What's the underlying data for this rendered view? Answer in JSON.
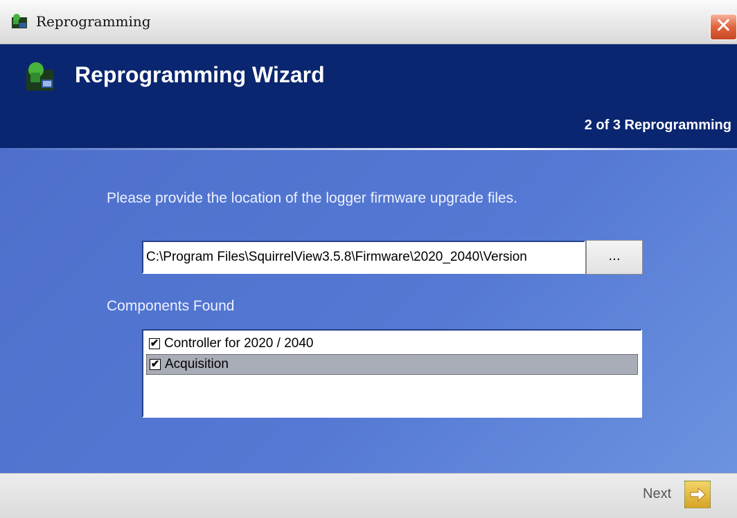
{
  "window": {
    "title": "Reprogramming",
    "close_glyph": "✕"
  },
  "header": {
    "title": "Reprogramming Wizard",
    "step": "2 of 3 Reprogramming"
  },
  "main": {
    "prompt": "Please provide the location of the logger firmware upgrade files.",
    "path_value": "C:\\Program Files\\SquirrelView3.5.8\\Firmware\\2020_2040\\Version",
    "browse_label": "...",
    "components_label": "Components Found",
    "components": [
      {
        "label": "Controller for 2020 / 2040",
        "checked": true,
        "selected": false
      },
      {
        "label": "Acquisition",
        "checked": true,
        "selected": true
      }
    ]
  },
  "footer": {
    "next_label": "Next"
  },
  "icons": {
    "app": "wizard-app-icon",
    "header": "wizard-header-icon",
    "next": "arrow-right-icon"
  },
  "colors": {
    "header_bg": "#0a2670",
    "body_bg": "#5478d3",
    "close_btn": "#e1643d"
  }
}
